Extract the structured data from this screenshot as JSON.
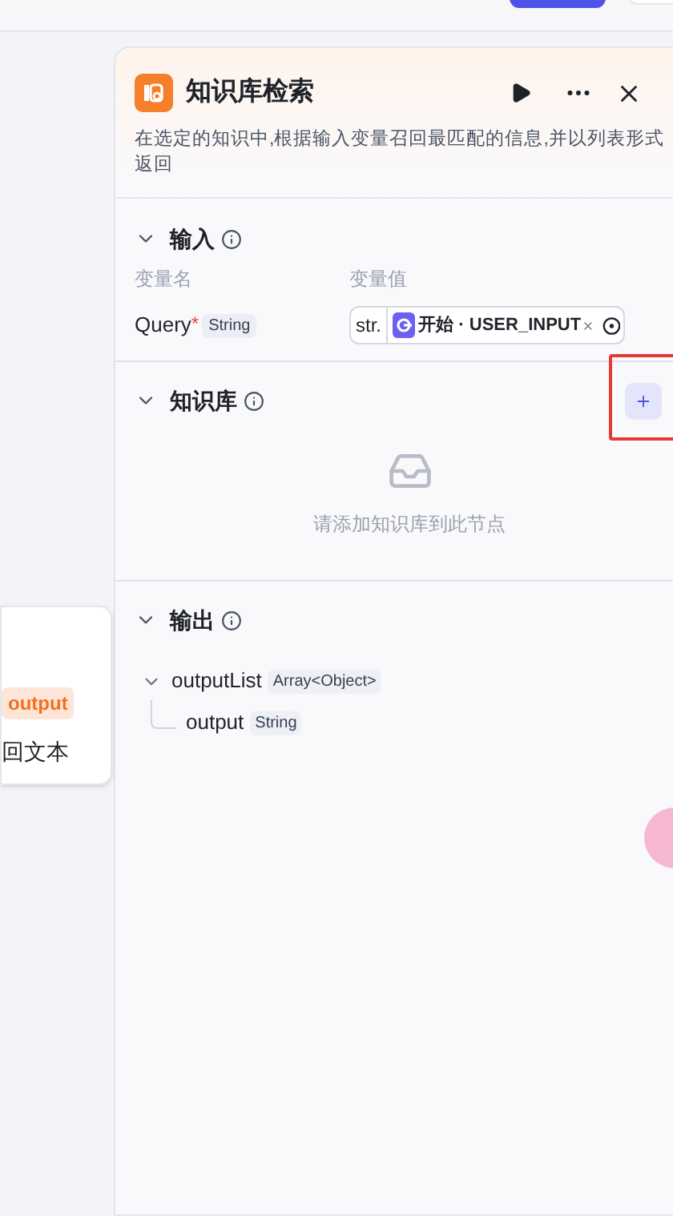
{
  "canvas_node": {
    "tag": "output",
    "text": "回文本"
  },
  "panel": {
    "title": "知识库检索",
    "description": "在选定的知识中,根据输入变量召回最匹配的信息,并以列表形式返回"
  },
  "input_section": {
    "title": "输入",
    "expanded": true,
    "columns": [
      "变量名",
      "变量值"
    ],
    "params": [
      {
        "name": "Query",
        "required": true,
        "required_mark": "*",
        "type": "String",
        "prefix": "str.",
        "reference": "开始 · USER_INPUT"
      }
    ]
  },
  "knowledge_section": {
    "title": "知识库",
    "expanded": true,
    "add_highlighted": true,
    "empty_text": "请添加知识库到此节点"
  },
  "output_section": {
    "title": "输出",
    "expanded": true,
    "tree": [
      {
        "name": "outputList",
        "type": "Array<Object>",
        "expanded": true,
        "children": [
          {
            "name": "output",
            "type": "String"
          }
        ]
      }
    ]
  }
}
